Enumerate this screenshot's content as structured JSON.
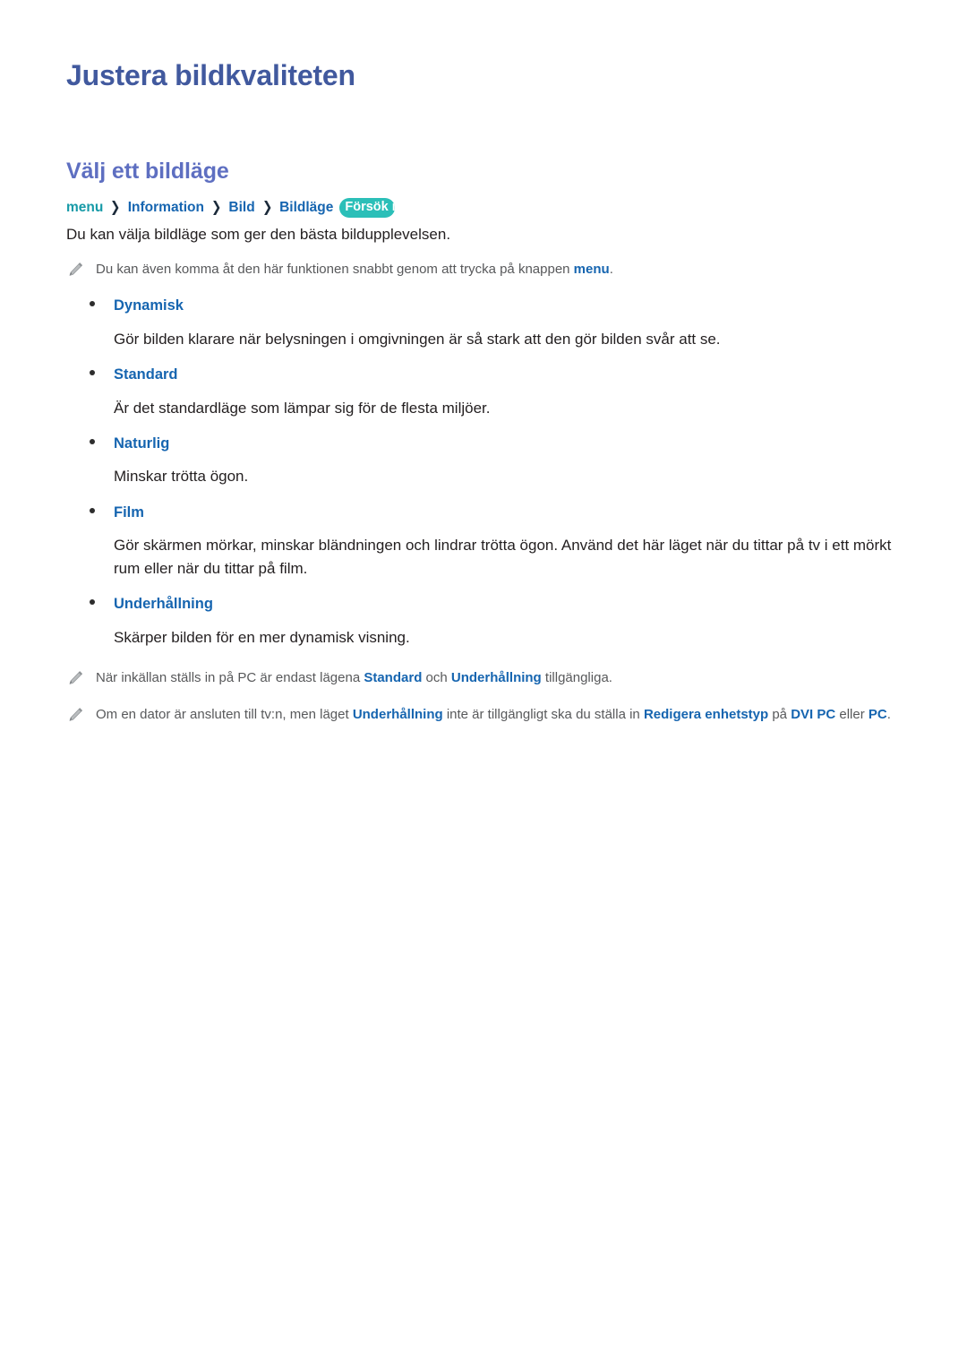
{
  "page": {
    "title": "Justera bildkvaliteten",
    "section_title": "Välj ett bildläge"
  },
  "colors": {
    "page_title": "#41599e",
    "section_title": "#5e6fc1",
    "crumb_menu": "#169aa7",
    "crumb_link": "#1665b0",
    "badge_bg": "#2bbfb8",
    "body_text": "#231f20",
    "note_text": "#58595b",
    "highlight": "#1665b0"
  },
  "breadcrumb": {
    "menu": "menu",
    "separator": "❯",
    "items": [
      {
        "label": "Information"
      },
      {
        "label": "Bild"
      },
      {
        "label": "Bildläge"
      }
    ],
    "try_now": "Försök nu"
  },
  "intro": "Du kan välja bildläge som ger den bästa bildupplevelsen.",
  "note_top": {
    "icon": "pencil-icon",
    "parts": [
      {
        "text": "Du kan även komma åt den här funktionen snabbt genom att trycka på knappen ",
        "bold": false
      },
      {
        "text": "menu",
        "bold": true
      },
      {
        "text": ".",
        "bold": false
      }
    ]
  },
  "modes": [
    {
      "label": "Dynamisk",
      "description": "Gör bilden klarare när belysningen i omgivningen är så stark att den gör bilden svår att se."
    },
    {
      "label": "Standard",
      "description": "Är det standardläge som lämpar sig för de flesta miljöer."
    },
    {
      "label": "Naturlig",
      "description": "Minskar trötta ögon."
    },
    {
      "label": "Film",
      "description": "Gör skärmen mörkar, minskar bländningen och lindrar trötta ögon. Använd det här läget när du tittar på tv i ett mörkt rum eller när du tittar på film."
    },
    {
      "label": "Underhållning",
      "description": "Skärper bilden för en mer dynamisk visning."
    }
  ],
  "notes_bottom": [
    {
      "icon": "pencil-icon",
      "parts": [
        {
          "text": "När inkällan ställs in på PC är endast lägena ",
          "bold": false
        },
        {
          "text": "Standard",
          "bold": true
        },
        {
          "text": " och ",
          "bold": false
        },
        {
          "text": "Underhållning",
          "bold": true
        },
        {
          "text": " tillgängliga.",
          "bold": false
        }
      ]
    },
    {
      "icon": "pencil-icon",
      "parts": [
        {
          "text": "Om en dator är ansluten till tv:n, men läget ",
          "bold": false
        },
        {
          "text": "Underhållning",
          "bold": true
        },
        {
          "text": " inte är tillgängligt ska du ställa in ",
          "bold": false
        },
        {
          "text": "Redigera enhetstyp",
          "bold": true
        },
        {
          "text": " på ",
          "bold": false
        },
        {
          "text": "DVI PC",
          "bold": true
        },
        {
          "text": " eller ",
          "bold": false
        },
        {
          "text": "PC",
          "bold": true
        },
        {
          "text": ".",
          "bold": false
        }
      ]
    }
  ]
}
